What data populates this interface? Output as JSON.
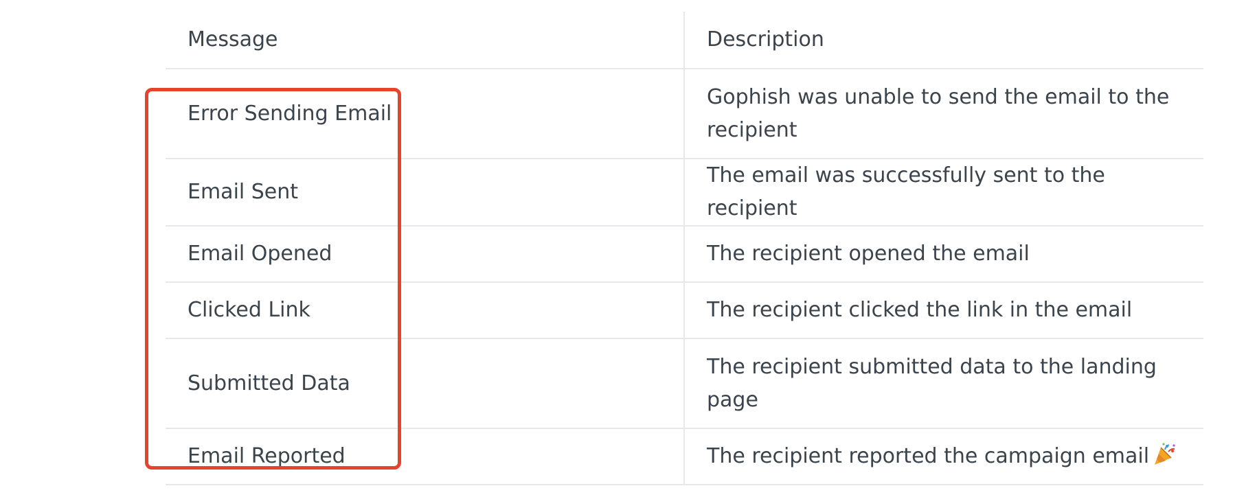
{
  "table": {
    "headers": {
      "message": "Message",
      "description": "Description"
    },
    "rows": [
      {
        "message": "Error Sending Email",
        "description": "Gophish was unable to send the email to the recipient"
      },
      {
        "message": "Email Sent",
        "description": "The email was successfully sent to the recipient"
      },
      {
        "message": "Email Opened",
        "description": "The recipient opened the email"
      },
      {
        "message": "Clicked Link",
        "description": "The recipient clicked the link in the email"
      },
      {
        "message": "Submitted Data",
        "description": "The recipient submitted data to the landing page"
      },
      {
        "message": "Email Reported",
        "description": "The recipient reported the campaign email",
        "icon": "party-popper-icon"
      }
    ]
  },
  "highlight": {
    "color": "#e5432c",
    "target": "message-column"
  },
  "colors": {
    "text": "#3b434b",
    "border": "#e6e8eb"
  }
}
